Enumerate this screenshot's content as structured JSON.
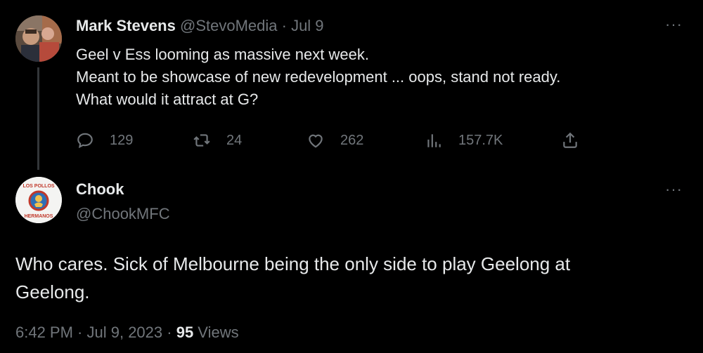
{
  "parent_tweet": {
    "author_name": "Mark Stevens",
    "handle": "@StevoMedia",
    "separator": " · ",
    "date": "Jul 9",
    "text_lines": [
      "Geel v Ess looming as massive next week.",
      "Meant to be showcase of new redevelopment ... oops, stand not ready.",
      "What would it attract at G?"
    ],
    "actions": {
      "replies": "129",
      "retweets": "24",
      "likes": "262",
      "views": "157.7K"
    },
    "more_label": "···"
  },
  "main_tweet": {
    "author_name": "Chook",
    "handle": "@ChookMFC",
    "text_lines": [
      "Who cares. Sick of Melbourne being the only side to play Geelong at",
      "Geelong."
    ],
    "time": "6:42 PM",
    "separator": " · ",
    "date": "Jul 9, 2023",
    "view_count": "95",
    "views_label": " Views",
    "avatar_text_top": "LOS POLLOS",
    "avatar_text_bottom": "HERMANOS",
    "more_label": "···"
  },
  "colors": {
    "background": "#000000",
    "primary_text": "#e7e9ea",
    "secondary_text": "#71767b",
    "thread_line": "#333639",
    "avatar_logo_accent": "#c0392b",
    "avatar_logo_blue": "#2f6fb5"
  },
  "icons": [
    "reply-icon",
    "retweet-icon",
    "like-icon",
    "views-icon",
    "share-icon",
    "more-icon"
  ]
}
